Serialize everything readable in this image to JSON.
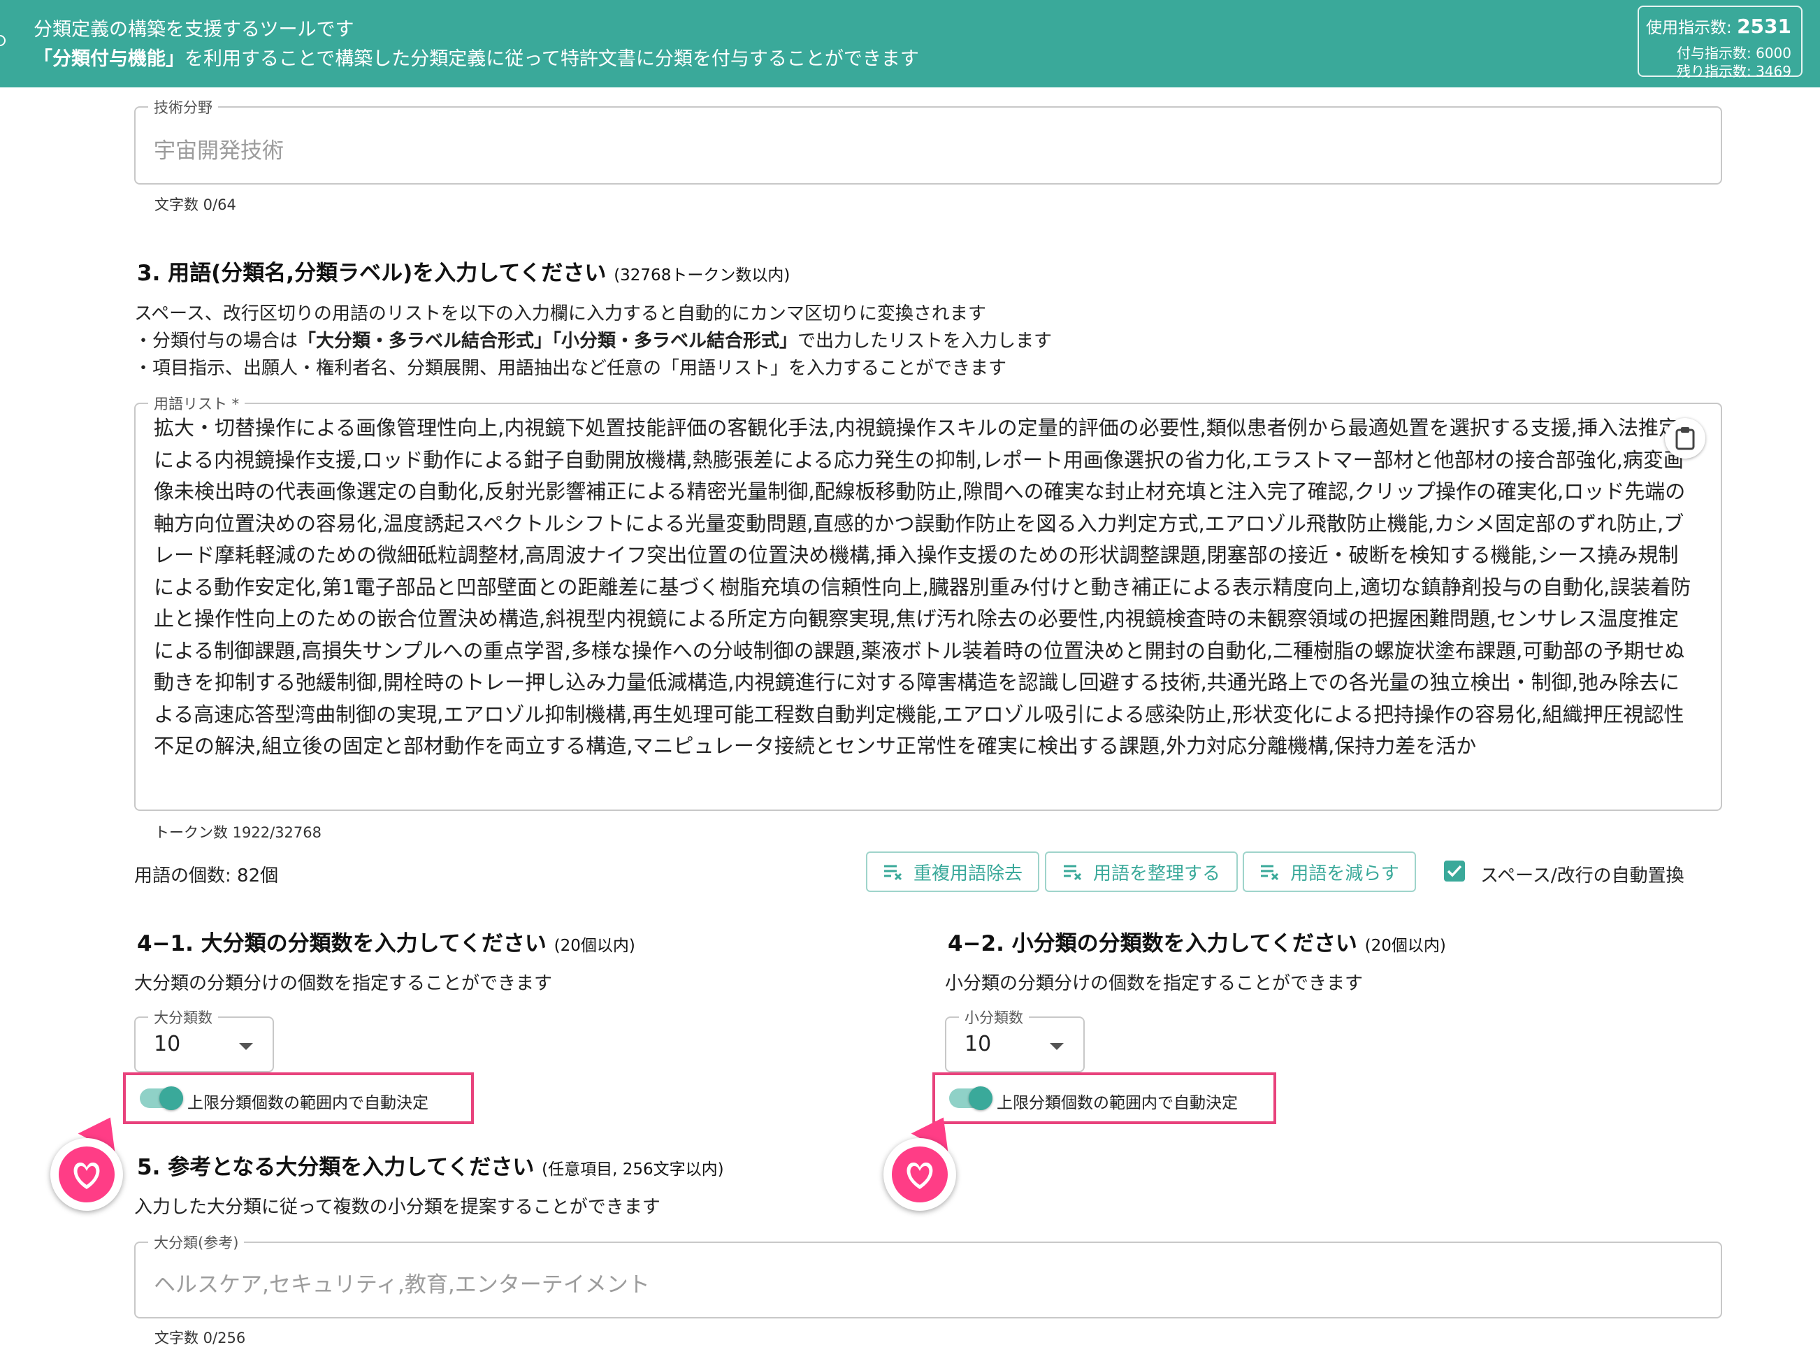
{
  "header": {
    "line1": "分類定義の構築を支援するツールです",
    "line2_bold": "「分類付与機能」",
    "line2_rest": "を利用することで構築した分類定義に従って特許文書に分類を付与することができます",
    "usage_label": "使用指示数:",
    "usage_value": "2531",
    "granted_label": "付与指示数: 6000",
    "remaining_label": "残り指示数: 3469"
  },
  "tech_field": {
    "label": "技術分野",
    "placeholder": "宇宙開発技術",
    "helper": "文字数 0/64"
  },
  "section3": {
    "heading": "3. 用語(分類名,分類ラベル)を入力してください",
    "heading_sub": "(32768トークン数以内)",
    "desc1": "スペース、改行区切りの用語のリストを以下の入力欄に入力すると自動的にカンマ区切りに変換されます",
    "desc2_pre": "・分類付与の場合は",
    "desc2_bold1": "「大分類・多ラベル結合形式」",
    "desc2_bold2": "「小分類・多ラベル結合形式」",
    "desc2_post": "で出力したリストを入力します",
    "desc3": "・項目指示、出願人・権利者名、分類展開、用語抽出など任意の「用語リスト」を入力することができます",
    "terms_label": "用語リスト *",
    "terms_text": "拡大・切替操作による画像管理性向上,内視鏡下処置技能評価の客観化手法,内視鏡操作スキルの定量的評価の必要性,類似患者例から最適処置を選択する支援,挿入法推定による内視鏡操作支援,ロッド動作による鉗子自動開放機構,熱膨張差による応力発生の抑制,レポート用画像選択の省力化,エラストマー部材と他部材の接合部強化,病変画像未検出時の代表画像選定の自動化,反射光影響補正による精密光量制御,配線板移動防止,隙間への確実な封止材充填と注入完了確認,クリップ操作の確実化,ロッド先端の軸方向位置決めの容易化,温度誘起スペクトルシフトによる光量変動問題,直感的かつ誤動作防止を図る入力判定方式,エアロゾル飛散防止機能,カシメ固定部のずれ防止,ブレード摩耗軽減のための微細砥粒調整材,高周波ナイフ突出位置の位置決め機構,挿入操作支援のための形状調整課題,閉塞部の接近・破断を検知する機能,シース撓み規制による動作安定化,第1電子部品と凹部壁面との距離差に基づく樹脂充填の信頼性向上,臓器別重み付けと動き補正による表示精度向上,適切な鎮静剤投与の自動化,誤装着防止と操作性向上のための嵌合位置決め構造,斜視型内視鏡による所定方向観察実現,焦げ汚れ除去の必要性,内視鏡検査時の未観察領域の把握困難問題,センサレス温度推定による制御課題,高損失サンプルへの重点学習,多様な操作への分岐制御の課題,薬液ボトル装着時の位置決めと開封の自動化,二種樹脂の螺旋状塗布課題,可動部の予期せぬ動きを抑制する弛緩制御,開栓時のトレー押し込み力量低減構造,内視鏡進行に対する障害構造を認識し回避する技術,共通光路上での各光量の独立検出・制御,弛み除去による高速応答型湾曲制御の実現,エアロゾル抑制機構,再生処理可能工程数自動判定機能,エアロゾル吸引による感染防止,形状変化による把持操作の容易化,組織押圧視認性不足の解決,組立後の固定と部材動作を両立する構造,マニピュレータ接続とセンサ正常性を確実に検出する課題,外力対応分離機構,保持力差を活か",
    "token_count": "トークン数 1922/32768",
    "term_count": "用語の個数: 82個",
    "btn_dedupe": "重複用語除去",
    "btn_organize": "用語を整理する",
    "btn_reduce": "用語を減らす",
    "auto_replace_label": "スペース/改行の自動置換",
    "auto_replace_checked": true
  },
  "section4_1": {
    "heading": "4−1. 大分類の分類数を入力してください",
    "heading_sub": "(20個以内)",
    "desc": "大分類の分類分けの個数を指定することができます",
    "select_label": "大分類数",
    "select_value": "10",
    "toggle_label": "上限分類個数の範囲内で自動決定",
    "toggle_on": true
  },
  "section4_2": {
    "heading": "4−2. 小分類の分類数を入力してください",
    "heading_sub": "(20個以内)",
    "desc": "小分類の分類分けの個数を指定することができます",
    "select_label": "小分類数",
    "select_value": "10",
    "toggle_label": "上限分類個数の範囲内で自動決定",
    "toggle_on": true
  },
  "section5": {
    "heading": "5. 参考となる大分類を入力してください",
    "heading_sub": "(任意項目, 256文字以内)",
    "desc": "入力した大分類に従って複数の小分類を提案することができます",
    "input_label": "大分類(参考)",
    "placeholder": "ヘルスケア,セキュリティ,教育,エンターテイメント",
    "helper": "文字数 0/256"
  },
  "colors": {
    "accent": "#3aa99a",
    "highlight": "#e8427c",
    "heart": "#ff3d86"
  }
}
